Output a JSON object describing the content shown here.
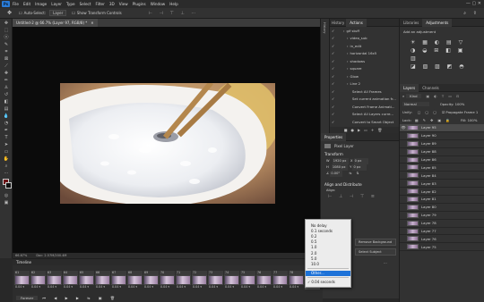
{
  "app": {
    "logo": "Ps"
  },
  "menu": [
    "File",
    "Edit",
    "Image",
    "Layer",
    "Type",
    "Select",
    "Filter",
    "3D",
    "View",
    "Plugins",
    "Window",
    "Help"
  ],
  "options_bar": {
    "auto_select": "Auto-Select:",
    "target": "Layer",
    "transform": "Show Transform Controls"
  },
  "document_tab": "Untitled-2 @ 66.7% (Layer 97, RGB/8) *",
  "status": {
    "zoom": "66.67%",
    "doc": "Doc: 2.57M/200.4M"
  },
  "history_tab": "History",
  "actions": {
    "tab": "Actions",
    "items": [
      "gif stuff",
      "video_sub",
      "in_edit",
      "horizontal 16x5",
      "shadows",
      "square",
      "Glow",
      "Line 2",
      "Select All Frames",
      "Set current animation fr...",
      "Convert Frame Animati...",
      "Select All Layers curre...",
      "Convert to Smart Object",
      "Layer to frame"
    ]
  },
  "libraries": {
    "tab1": "Libraries",
    "tab2": "Adjustments",
    "add": "Add an adjustment"
  },
  "properties": {
    "tab": "Properties",
    "kind": "Pixel Layer",
    "transform": "Transform",
    "w": "1920 px",
    "h": "1080 px",
    "x": "0 px",
    "y": "0 px",
    "angle": "0.00°",
    "align": "Align and Distribute",
    "align_sub": "Align:",
    "remove_bg": "Remove Background",
    "select_subject": "Select Subject",
    "more": "..."
  },
  "layers": {
    "tab1": "Layers",
    "tab2": "Channels",
    "filter": "Kind",
    "blend": "Normal",
    "opacity": "Opacity: 100%",
    "unify": "Unify:",
    "propagate": "Propagate Frame 1",
    "lock": "Lock:",
    "fill": "Fill: 100%",
    "items": [
      "Layer 95",
      "Layer 90",
      "Layer 89",
      "Layer 88",
      "Layer 86",
      "Layer 85",
      "Layer 84",
      "Layer 83",
      "Layer 82",
      "Layer 81",
      "Layer 80",
      "Layer 79",
      "Layer 78",
      "Layer 77",
      "Layer 76",
      "Layer 75"
    ]
  },
  "timeline": {
    "title": "Timeline",
    "frames": [
      {
        "n": "61",
        "d": "0.04"
      },
      {
        "n": "62",
        "d": "0.04"
      },
      {
        "n": "63",
        "d": "0.04"
      },
      {
        "n": "64",
        "d": "0.04"
      },
      {
        "n": "65",
        "d": "0.04"
      },
      {
        "n": "66",
        "d": "0.04"
      },
      {
        "n": "67",
        "d": "0.04"
      },
      {
        "n": "68",
        "d": "0.04"
      },
      {
        "n": "69",
        "d": "0.04"
      },
      {
        "n": "70",
        "d": "0.04"
      },
      {
        "n": "71",
        "d": "0.04"
      },
      {
        "n": "72",
        "d": "0.04"
      },
      {
        "n": "73",
        "d": "0.04"
      },
      {
        "n": "74",
        "d": "0.04"
      },
      {
        "n": "75",
        "d": "0.04"
      },
      {
        "n": "76",
        "d": "0.04"
      },
      {
        "n": "77",
        "d": "0.04"
      },
      {
        "n": "78",
        "d": "0.04"
      },
      {
        "n": "79",
        "d": "0.04"
      }
    ],
    "loop": "Forever"
  },
  "delay_menu": {
    "items": [
      "No delay",
      "0.1 seconds",
      "0.2",
      "0.5",
      "1.0",
      "2.0",
      "5.0",
      "10.0"
    ],
    "other": "Other...",
    "current": "0.04 seconds"
  }
}
